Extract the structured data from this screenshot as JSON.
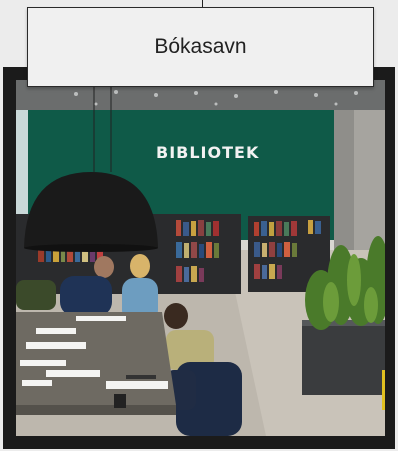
{
  "title": {
    "label": "Bókasavn"
  },
  "photo": {
    "sign_text": "BIBLIOTEK",
    "wall_color": "#0f5a48",
    "lamp_color": "#1a1a1a",
    "table_color": "#6e6a62"
  }
}
